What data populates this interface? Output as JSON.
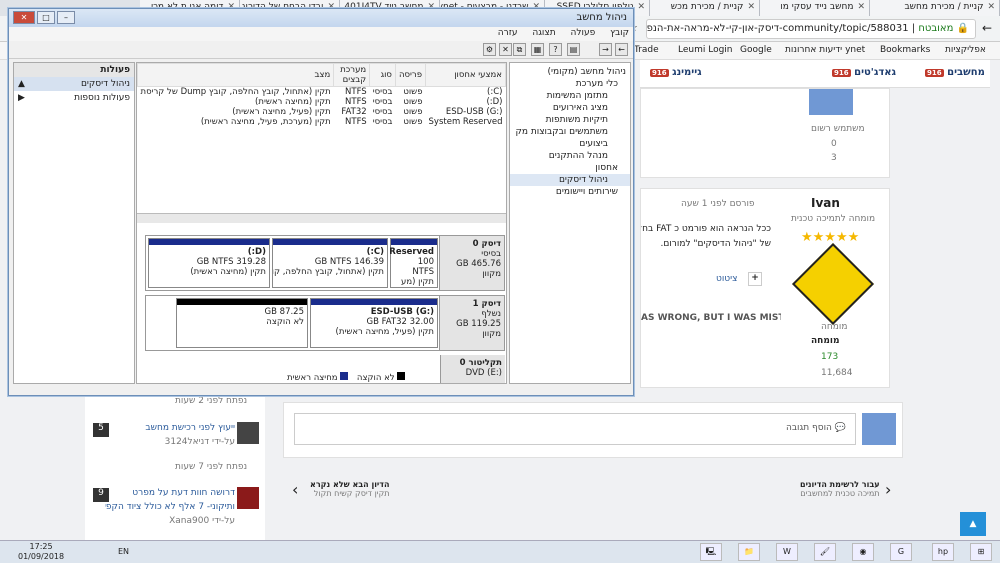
{
  "tabs": [
    {
      "label": "קניית / מכירת מחשב"
    },
    {
      "label": "מחשב נייד עסקי מו"
    },
    {
      "label": "קניית / מכירת מכש"
    },
    {
      "label": "טלפון סלולרי SSED"
    },
    {
      "label": "שרדנו - מבצעים - ynet"
    },
    {
      "label": "מחשב נייד 401J4TV"
    },
    {
      "label": "ובדי הבחם של הדירוג"
    },
    {
      "label": "דומה אני ת לא מכי"
    }
  ],
  "address": {
    "secure": "מאובטח",
    "url": "community/topic/588031-דיסק-און-קי-לא-מראה-את-הנפח-הנכון/"
  },
  "bookmarks": [
    {
      "label": "אפליקציות"
    },
    {
      "label": "Bookmarks"
    },
    {
      "label": "ידיעות אחרונות ynet"
    },
    {
      "label": "Google"
    },
    {
      "label": "Leumi Login"
    },
    {
      "label": "Trade"
    }
  ],
  "site": {
    "nav": [
      {
        "label": "מחשבים",
        "count": "916"
      },
      {
        "label": "גאדג'טים",
        "count": "916"
      },
      {
        "label": "גיימינג",
        "count": "916"
      }
    ],
    "top_user": {
      "role": "משתמש רשום",
      "posts": "0",
      "rep": "3"
    },
    "poster": {
      "name": "Ivan",
      "title": "מומחה לתמיכה טכנית",
      "rank": "מומחה",
      "badge": "מומחה",
      "rep": "173",
      "posts": "11,684",
      "stars": "★★★★★"
    },
    "post": {
      "time": "פורסם לפני 1 שעה",
      "line1": "ככל הנראה הוא פורמט כ FAT בחלונות ומכ",
      "line2": "של \"ניהול הדיסקים\" למורום.",
      "quote_btn": "ציטוט",
      "plus": "+",
      "banner": "AS WRONG, BUT I WAS MISTAKEN"
    },
    "reply_placeholder": "הוסף תגובה",
    "prev": {
      "label": "עבור לרשימת הדיונים",
      "sub": "תמיכה טכנית למחשבים"
    },
    "next": {
      "label": "הדיון הבא שלא נקרא",
      "sub": "תקין דיסק קשיח תקול"
    },
    "sidebar": [
      {
        "time": "נפתח לפני 2 שעות"
      },
      {
        "num": "5",
        "title": "ייעוץ לפני רכישת מחשב",
        "by": "על-ידי דניאל3124",
        "time": "נפתח לפני 7 שעות"
      },
      {
        "num": "9",
        "title": "דרושה חוות דעת על מפרט",
        "title2": "ותיקוני- 7 אלף לא כולל ציוד הקפי",
        "by": "על-ידי Xana900"
      }
    ]
  },
  "cm": {
    "title": "ניהול מחשב",
    "menu": [
      "קובץ",
      "פעולה",
      "תצוגה",
      "עזרה"
    ],
    "tree": [
      "ניהול מחשב (מקומי)",
      "כלי מערכת",
      "מתזמן המשימות",
      "מציג האירועים",
      "תיקיות משותפות",
      "משתמשים ובקבוצות מק",
      "ביצועים",
      "מנהל ההתקנים",
      "אחסון",
      "ניהול דיסקים",
      "שירותים ויישומים"
    ],
    "actions": {
      "header": "פעולות",
      "item1": "ניהול דיסקים",
      "item2": "פעולות נוספות"
    },
    "columns": [
      "אמצעי אחסון",
      "פריסה",
      "סוג",
      "מערכת קבצים",
      "מצב"
    ],
    "volumes": [
      {
        "name": "(C:)",
        "layout": "פשוט",
        "type": "בסיסי",
        "fs": "NTFS",
        "status": "תקין (אתחול, קובץ החלפה, קובץ Dump של קריסת"
      },
      {
        "name": "(D:)",
        "layout": "פשוט",
        "type": "בסיסי",
        "fs": "NTFS",
        "status": "תקין (מחיצה ראשית)"
      },
      {
        "name": "ESD-USB (G:)",
        "layout": "פשוט",
        "type": "בסיסי",
        "fs": "FAT32",
        "status": "תקין (פעיל, מחיצה ראשית)"
      },
      {
        "name": "System Reserved",
        "layout": "פשוט",
        "type": "בסיסי",
        "fs": "NTFS",
        "status": "תקין (מערכת, פעיל, מחיצה ראשית)"
      }
    ],
    "disk0": {
      "name": "דיסק 0",
      "type": "בסיסי",
      "size": "465.76 GB",
      "state": "מקוון",
      "parts": [
        {
          "title": "Reserved",
          "l2": "100 NTFS",
          "l3": "תקין (מע"
        },
        {
          "title": "(C:)",
          "l2": "146.39 GB NTFS",
          "l3": "תקין (אתחול, קובץ החלפה, קו"
        },
        {
          "title": "(D:)",
          "l2": "319.28 GB NTFS",
          "l3": "תקין (מחיצה ראשית)"
        }
      ]
    },
    "disk1": {
      "name": "דיסק 1",
      "type": "נשלף",
      "size": "119.25 GB",
      "state": "מקוון",
      "parts": [
        {
          "title": "ESD-USB (G:)",
          "l2": "32.00 GB FAT32",
          "l3": "תקין (פעיל, מחיצה ראשית)"
        },
        {
          "title": "87.25 GB",
          "l2": "לא הוקצה",
          "l3": ""
        }
      ]
    },
    "cdrom": {
      "name": "תקליטור 0",
      "l2": "DVD (E:)"
    },
    "legend": {
      "unalloc": "לא הוקצה",
      "primary": "מחיצה ראשית"
    }
  },
  "taskbar": {
    "time": "17:25",
    "date": "01/09/2018",
    "lang": "EN"
  }
}
